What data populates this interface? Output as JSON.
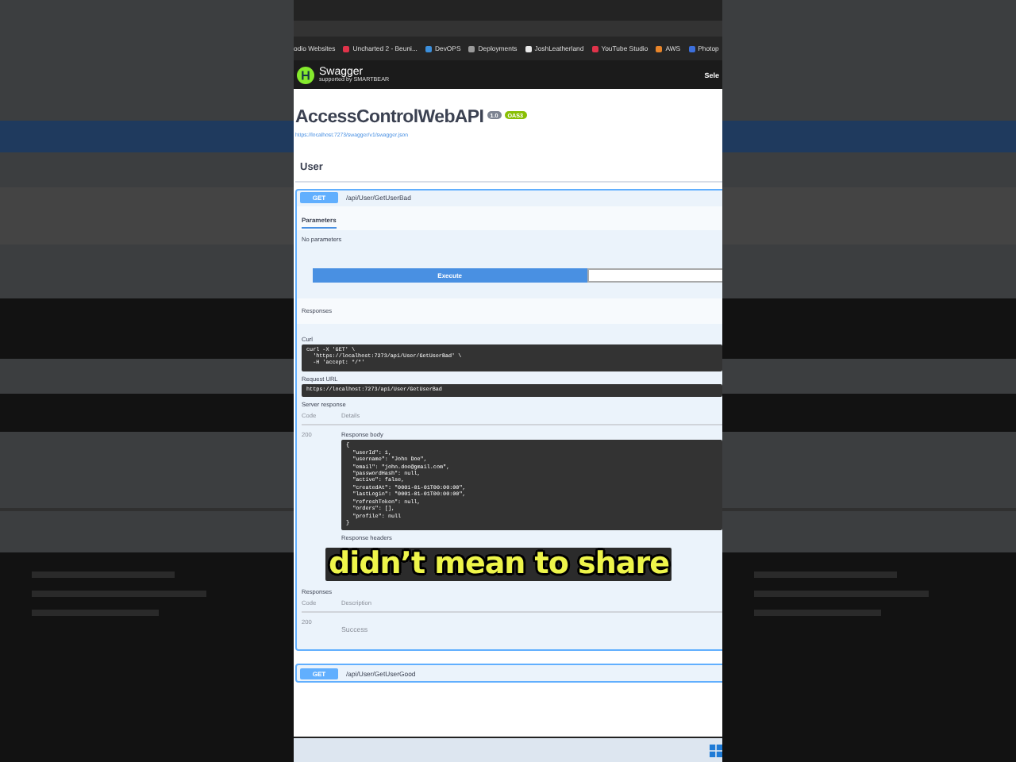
{
  "browser": {
    "bookmarks": [
      {
        "label": "odio Websites"
      },
      {
        "label": "Uncharted 2 - Beuni...",
        "color": "#e0334a"
      },
      {
        "label": "DevOPS",
        "color": "#3c8fdc"
      },
      {
        "label": "Deployments",
        "color": "#9a9a9a"
      },
      {
        "label": "JoshLeatherland",
        "color": "#e8e8e8"
      },
      {
        "label": "YouTube Studio",
        "color": "#e0334a"
      },
      {
        "label": "AWS",
        "color": "#e8852a"
      },
      {
        "label": "Photop",
        "color": "#3c6fdc"
      }
    ]
  },
  "header": {
    "logo": "Swagger",
    "logo_subtitle": "supported by SMARTBEAR",
    "select_label": "Sele"
  },
  "api": {
    "title": "AccessControlWebAPI",
    "version": "1.0",
    "oas": "OAS3",
    "spec_url": "https://localhost:7273/swagger/v1/swagger.json"
  },
  "section": {
    "title": "User"
  },
  "operations": [
    {
      "method": "GET",
      "path": "/api/User/GetUserBad",
      "expanded": true,
      "parameters_tab": "Parameters",
      "no_parameters": "No parameters",
      "execute": "Execute",
      "responses_title": "Responses",
      "curl_label": "Curl",
      "curl_lines": [
        "curl -X 'GET' \\",
        "  'https://localhost:7273/api/User/GetUserBad' \\",
        "  -H 'accept: */*'"
      ],
      "request_url_label": "Request URL",
      "request_url": "https://localhost:7273/api/User/GetUserBad",
      "server_response_label": "Server response",
      "code_header": "Code",
      "details_header": "Details",
      "response_code": "200",
      "response_body_label": "Response body",
      "response_body": [
        "{",
        "  \"userId\": 1,",
        "  \"username\": \"John Doe\",",
        "  \"email\": \"john.doe@gmail.com\",",
        "  \"passwordHash\": null,",
        "  \"active\": false,",
        "  \"createdAt\": \"0001-01-01T00:00:00\",",
        "  \"lastLogin\": \"0001-01-01T00:00:00\",",
        "  \"refreshToken\": null,",
        "  \"orders\": [],",
        "  \"profile\": null",
        "}"
      ],
      "response_headers_label": "Response headers",
      "responses": {
        "title": "Responses",
        "code_header": "Code",
        "description_header": "Description",
        "rows": [
          {
            "code": "200",
            "description": "Success"
          }
        ]
      }
    },
    {
      "method": "GET",
      "path": "/api/User/GetUserGood",
      "expanded": false
    }
  ],
  "caption": "didn’t mean to share"
}
